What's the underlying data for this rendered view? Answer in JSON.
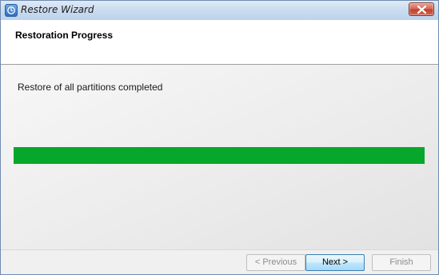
{
  "window": {
    "title": "Restore Wizard",
    "icon": "restore-wizard-app-icon",
    "close_icon": "close-icon"
  },
  "header": {
    "title": "Restoration Progress"
  },
  "body": {
    "status_text": "Restore of all partitions completed",
    "progress_fraction": 1.0,
    "progress_color": "#07a72b"
  },
  "footer": {
    "previous_label": "< Previous",
    "next_label": "Next >",
    "finish_label": "Finish"
  }
}
